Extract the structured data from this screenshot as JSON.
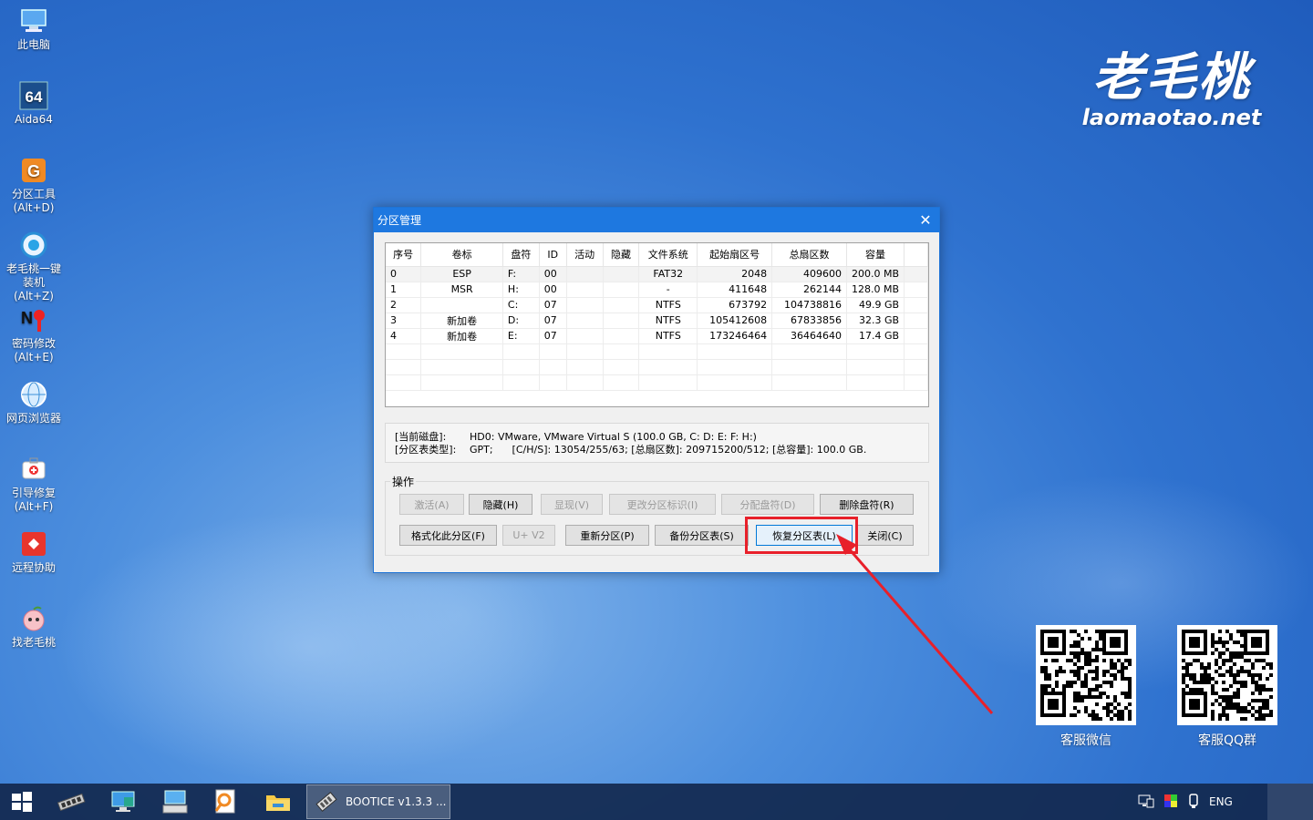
{
  "desktop": {
    "icons": [
      {
        "label": "此电脑",
        "icon": "computer-icon"
      },
      {
        "label": "Aida64",
        "icon": "aida64-icon"
      },
      {
        "label": "分区工具\n(Alt+D)",
        "icon": "partition-tool-icon"
      },
      {
        "label": "老毛桃一键\n装机(Alt+Z)",
        "icon": "installer-icon"
      },
      {
        "label": "密码修改\n(Alt+E)",
        "icon": "password-icon"
      },
      {
        "label": "网页浏览器",
        "icon": "browser-icon"
      },
      {
        "label": "引导修复\n(Alt+F)",
        "icon": "boot-repair-icon"
      },
      {
        "label": "远程协助",
        "icon": "remote-assist-icon"
      },
      {
        "label": "找老毛桃",
        "icon": "peach-icon"
      }
    ],
    "brand": {
      "name": "老毛桃",
      "url": "laomaotao.net"
    },
    "qr": [
      {
        "caption": "客服微信"
      },
      {
        "caption": "客服QQ群"
      }
    ]
  },
  "dialog": {
    "title": "分区管理",
    "table": {
      "headers": [
        "序号",
        "卷标",
        "盘符",
        "ID",
        "活动",
        "隐藏",
        "文件系统",
        "起始扇区号",
        "总扇区数",
        "容量"
      ],
      "rows": [
        [
          "0",
          "ESP",
          "F:",
          "00",
          "",
          "",
          "FAT32",
          "2048",
          "409600",
          "200.0 MB"
        ],
        [
          "1",
          "MSR",
          "H:",
          "00",
          "",
          "",
          "-",
          "411648",
          "262144",
          "128.0 MB"
        ],
        [
          "2",
          "",
          "C:",
          "07",
          "",
          "",
          "NTFS",
          "673792",
          "104738816",
          "49.9 GB"
        ],
        [
          "3",
          "新加卷",
          "D:",
          "07",
          "",
          "",
          "NTFS",
          "105412608",
          "67833856",
          "32.3 GB"
        ],
        [
          "4",
          "新加卷",
          "E:",
          "07",
          "",
          "",
          "NTFS",
          "173246464",
          "36464640",
          "17.4 GB"
        ]
      ]
    },
    "info": {
      "disk_key": "[当前磁盘]:",
      "disk_val": "HD0: VMware, VMware Virtual S (100.0 GB, C: D: E: F: H:)",
      "type_key": "[分区表类型]:",
      "type_val": "GPT;      [C/H/S]: 13054/255/63; [总扇区数]: 209715200/512; [总容量]: 100.0 GB."
    },
    "ops_label": "操作",
    "buttons": {
      "activate": "激活(A)",
      "hide": "隐藏(H)",
      "show": "显现(V)",
      "change_id": "更改分区标识(I)",
      "assign_letter": "分配盘符(D)",
      "remove_letter": "删除盘符(R)",
      "format": "格式化此分区(F)",
      "uv2": "U+ V2",
      "repartition": "重新分区(P)",
      "backup": "备份分区表(S)",
      "restore": "恢复分区表(L)",
      "close": "关闭(C)"
    }
  },
  "taskbar": {
    "app_label": "BOOTICE v1.3.3 ...",
    "lang": "ENG"
  },
  "colors": {
    "accent": "#1e78e0",
    "highlight": "#e8202a"
  }
}
